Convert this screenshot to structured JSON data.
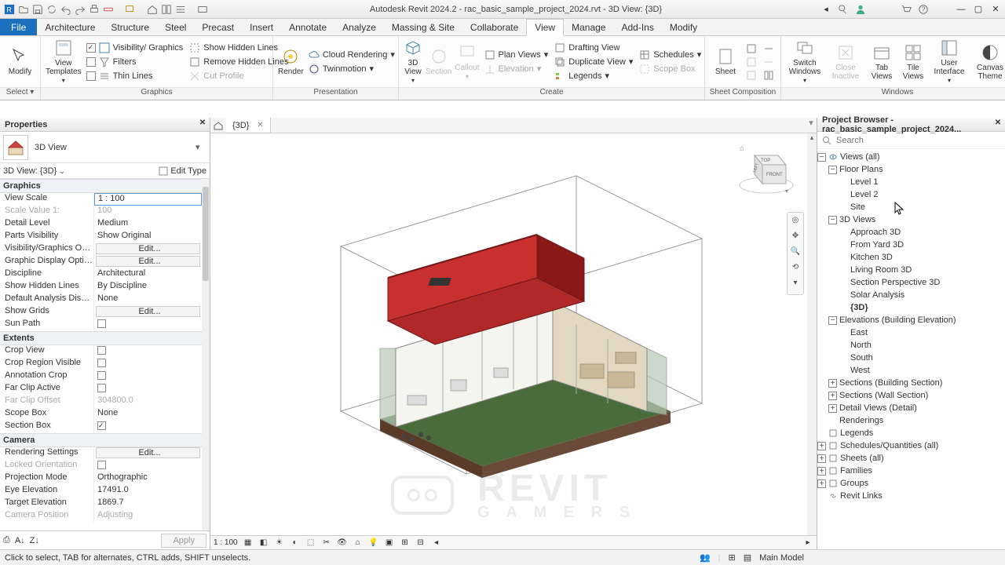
{
  "title": "Autodesk Revit 2024.2 - rac_basic_sample_project_2024.rvt - 3D View: {3D}",
  "ribbon_tabs": [
    "Architecture",
    "Structure",
    "Steel",
    "Precast",
    "Insert",
    "Annotate",
    "Analyze",
    "Massing & Site",
    "Collaborate",
    "View",
    "Manage",
    "Add-Ins",
    "Modify"
  ],
  "active_tab": "View",
  "file_tab": "File",
  "select_label": "Select",
  "ribbon": {
    "modify": "Modify",
    "view_templates": "View\nTemplates",
    "visibility_graphics": "Visibility/ Graphics",
    "filters": "Filters",
    "thin_lines": "Thin  Lines",
    "show_hidden": "Show  Hidden Lines",
    "remove_hidden": "Remove  Hidden Lines",
    "cut_profile": "Cut  Profile",
    "render": "Render",
    "cloud_rendering": "Cloud  Rendering",
    "twinmotion": "Twinmotion",
    "three_d_view": "3D\nView",
    "section": "Section",
    "callout": "Callout",
    "plan_views": "Plan  Views",
    "elevation": "Elevation",
    "drafting_view": "Drafting  View",
    "duplicate_view": "Duplicate  View",
    "legends": "Legends",
    "schedules": "Schedules",
    "scope_box": "Scope  Box",
    "sheet": "Sheet",
    "switch_windows": "Switch\nWindows",
    "close_inactive": "Close\nInactive",
    "tab_views": "Tab\nViews",
    "tile_views": "Tile\nViews",
    "user_interface": "User\nInterface",
    "canvas_theme": "Canvas\nTheme",
    "groups": {
      "graphics": "Graphics",
      "presentation": "Presentation",
      "create": "Create",
      "sheet_comp": "Sheet Composition",
      "windows": "Windows"
    }
  },
  "properties": {
    "title": "Properties",
    "type_name": "3D View",
    "instance": "3D View: {3D}",
    "edit_type": "Edit Type",
    "apply": "Apply",
    "cats": {
      "graphics": "Graphics",
      "extents": "Extents",
      "camera": "Camera"
    },
    "rows": [
      {
        "n": "View Scale",
        "v": "1 : 100",
        "sel": true
      },
      {
        "n": "Scale Value    1:",
        "v": "100",
        "dis": true
      },
      {
        "n": "Detail Level",
        "v": "Medium"
      },
      {
        "n": "Parts Visibility",
        "v": "Show Original"
      },
      {
        "n": "Visibility/Graphics Overr...",
        "v": "Edit...",
        "btn": true
      },
      {
        "n": "Graphic Display Options",
        "v": "Edit...",
        "btn": true
      },
      {
        "n": "Discipline",
        "v": "Architectural"
      },
      {
        "n": "Show Hidden Lines",
        "v": "By Discipline"
      },
      {
        "n": "Default Analysis Display...",
        "v": "None"
      },
      {
        "n": "Show Grids",
        "v": "Edit...",
        "btn": true
      },
      {
        "n": "Sun Path",
        "chk": false
      }
    ],
    "extents_rows": [
      {
        "n": "Crop View",
        "chk": false
      },
      {
        "n": "Crop Region Visible",
        "chk": false
      },
      {
        "n": "Annotation Crop",
        "chk": false
      },
      {
        "n": "Far Clip Active",
        "chk": false
      },
      {
        "n": "Far Clip Offset",
        "v": "304800.0",
        "dis": true
      },
      {
        "n": "Scope Box",
        "v": "None"
      },
      {
        "n": "Section Box",
        "chk": true
      }
    ],
    "camera_rows": [
      {
        "n": "Rendering Settings",
        "v": "Edit...",
        "btn": true
      },
      {
        "n": "Locked Orientation",
        "chk": false,
        "dis": true
      },
      {
        "n": "Projection Mode",
        "v": "Orthographic"
      },
      {
        "n": "Eye Elevation",
        "v": "17491.0"
      },
      {
        "n": "Target Elevation",
        "v": "1869.7"
      },
      {
        "n": "Camera Position",
        "v": "Adjusting",
        "dis": true
      }
    ]
  },
  "view_tab": "{3D}",
  "view_scale_ctrl": "1 : 100",
  "browser": {
    "title": "Project Browser - rac_basic_sample_project_2024...",
    "search": "Search",
    "views_all": "Views (all)",
    "floor_plans": "Floor Plans",
    "fp_items": [
      "Level 1",
      "Level 2",
      "Site"
    ],
    "three_d": "3D Views",
    "td_items": [
      "Approach 3D",
      "From Yard 3D",
      "Kitchen 3D",
      "Living Room 3D",
      "Section Perspective 3D",
      "Solar Analysis",
      "{3D}"
    ],
    "elev": "Elevations (Building Elevation)",
    "elev_items": [
      "East",
      "North",
      "South",
      "West"
    ],
    "sections_bs": "Sections (Building Section)",
    "sections_ws": "Sections (Wall Section)",
    "detail_views": "Detail Views (Detail)",
    "renderings": "Renderings",
    "legends": "Legends",
    "schedules": "Schedules/Quantities (all)",
    "sheets": "Sheets (all)",
    "families": "Families",
    "groups": "Groups",
    "revit_links": "Revit Links"
  },
  "status": {
    "hint": "Click to select, TAB for alternates, CTRL adds, SHIFT unselects.",
    "main_model": "Main Model"
  },
  "watermark": {
    "line1": "REVIT",
    "line2": "G A M E R S"
  }
}
